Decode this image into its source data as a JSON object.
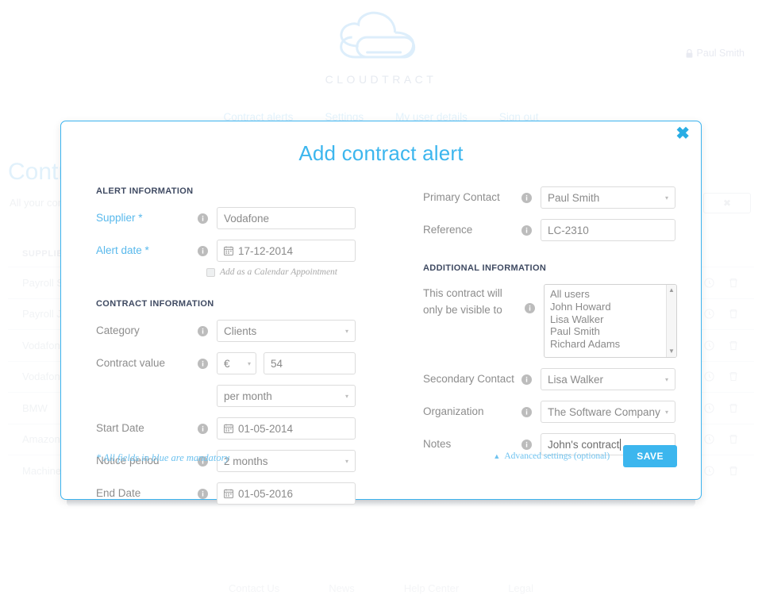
{
  "brand": {
    "wordmark": "CLOUDTRACT",
    "logo_icon": "cloud-paperclip-logo"
  },
  "user": {
    "name": "Paul Smith",
    "icon": "lock-icon"
  },
  "topnav": {
    "items": [
      {
        "label": "Contract alerts"
      },
      {
        "label": "Settings"
      },
      {
        "label": "My user details"
      },
      {
        "label": "Sign out"
      }
    ]
  },
  "background_page": {
    "title": "Contracts",
    "subtitle": "All your contracts",
    "search_clear": "✖",
    "table": {
      "columns": [
        "SUPPLIER"
      ],
      "rows": [
        {
          "supplier": "Payroll Services"
        },
        {
          "supplier": "Payroll Joe"
        },
        {
          "supplier": "Vodafone"
        },
        {
          "supplier": "Vodafone"
        },
        {
          "supplier": "BMW"
        },
        {
          "supplier": "Amazon"
        },
        {
          "supplier": "Machines Inc"
        }
      ],
      "row_actions": [
        "clock-icon",
        "trash-icon"
      ]
    }
  },
  "footer": {
    "links": [
      "Contact Us",
      "News",
      "Help Center",
      "Legal"
    ]
  },
  "modal": {
    "title": "Add contract alert",
    "close_label": "✖",
    "sections": {
      "alert_information": {
        "heading": "ALERT INFORMATION",
        "supplier": {
          "label": "Supplier *",
          "value": "Vodafone"
        },
        "alert_date": {
          "label": "Alert date *",
          "value": "17-12-2014",
          "icon": "calendar-icon"
        },
        "calendar_checkbox": {
          "label": "Add as a Calendar Appointment",
          "checked": false
        }
      },
      "contract_information": {
        "heading": "CONTRACT INFORMATION",
        "category": {
          "label": "Category",
          "value": "Clients"
        },
        "contract_value": {
          "label": "Contract value",
          "currency": "€",
          "amount": "54"
        },
        "frequency": {
          "value": "per month"
        },
        "start_date": {
          "label": "Start Date",
          "value": "01-05-2014",
          "icon": "calendar-icon"
        },
        "notice_period": {
          "label": "Notice period",
          "value": "2 months"
        },
        "end_date": {
          "label": "End Date",
          "value": "01-05-2016",
          "icon": "calendar-icon"
        }
      },
      "additional_information": {
        "heading": "ADDITIONAL INFORMATION",
        "primary_contact": {
          "label": "Primary Contact",
          "value": "Paul Smith"
        },
        "reference": {
          "label": "Reference",
          "value": "LC-2310"
        },
        "visibility": {
          "label_line1": "This contract will",
          "label_line2": "only be visible to",
          "options": [
            "All users",
            "John Howard",
            "Lisa Walker",
            "Paul Smith",
            "Richard Adams"
          ]
        },
        "secondary_contact": {
          "label": "Secondary Contact",
          "value": "Lisa Walker"
        },
        "organization": {
          "label": "Organization",
          "value": "The Software Company"
        },
        "notes": {
          "label": "Notes",
          "value": "John's contract"
        }
      }
    },
    "mandatory_note": "* All fields in blue are mandatory",
    "advanced_settings": {
      "label": "Advanced settings (optional)",
      "icon": "chevron-up-icon"
    },
    "save_button": "SAVE"
  },
  "colors": {
    "accent": "#3cb6ee",
    "title": "#3cb6ee",
    "label_required": "#59b9ec",
    "label": "#8d8d8d",
    "section_head": "#3f4a62",
    "border": "#dcdcdc"
  }
}
